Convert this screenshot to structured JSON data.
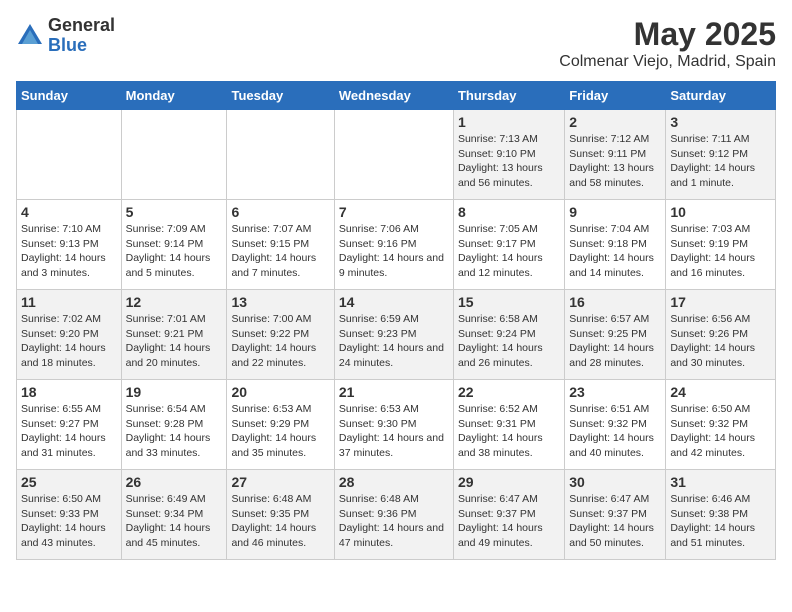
{
  "logo": {
    "general": "General",
    "blue": "Blue"
  },
  "title": "May 2025",
  "subtitle": "Colmenar Viejo, Madrid, Spain",
  "days_header": [
    "Sunday",
    "Monday",
    "Tuesday",
    "Wednesday",
    "Thursday",
    "Friday",
    "Saturday"
  ],
  "weeks": [
    [
      {
        "day": "",
        "sunrise": "",
        "sunset": "",
        "daylight": ""
      },
      {
        "day": "",
        "sunrise": "",
        "sunset": "",
        "daylight": ""
      },
      {
        "day": "",
        "sunrise": "",
        "sunset": "",
        "daylight": ""
      },
      {
        "day": "",
        "sunrise": "",
        "sunset": "",
        "daylight": ""
      },
      {
        "day": "1",
        "sunrise": "Sunrise: 7:13 AM",
        "sunset": "Sunset: 9:10 PM",
        "daylight": "Daylight: 13 hours and 56 minutes."
      },
      {
        "day": "2",
        "sunrise": "Sunrise: 7:12 AM",
        "sunset": "Sunset: 9:11 PM",
        "daylight": "Daylight: 13 hours and 58 minutes."
      },
      {
        "day": "3",
        "sunrise": "Sunrise: 7:11 AM",
        "sunset": "Sunset: 9:12 PM",
        "daylight": "Daylight: 14 hours and 1 minute."
      }
    ],
    [
      {
        "day": "4",
        "sunrise": "Sunrise: 7:10 AM",
        "sunset": "Sunset: 9:13 PM",
        "daylight": "Daylight: 14 hours and 3 minutes."
      },
      {
        "day": "5",
        "sunrise": "Sunrise: 7:09 AM",
        "sunset": "Sunset: 9:14 PM",
        "daylight": "Daylight: 14 hours and 5 minutes."
      },
      {
        "day": "6",
        "sunrise": "Sunrise: 7:07 AM",
        "sunset": "Sunset: 9:15 PM",
        "daylight": "Daylight: 14 hours and 7 minutes."
      },
      {
        "day": "7",
        "sunrise": "Sunrise: 7:06 AM",
        "sunset": "Sunset: 9:16 PM",
        "daylight": "Daylight: 14 hours and 9 minutes."
      },
      {
        "day": "8",
        "sunrise": "Sunrise: 7:05 AM",
        "sunset": "Sunset: 9:17 PM",
        "daylight": "Daylight: 14 hours and 12 minutes."
      },
      {
        "day": "9",
        "sunrise": "Sunrise: 7:04 AM",
        "sunset": "Sunset: 9:18 PM",
        "daylight": "Daylight: 14 hours and 14 minutes."
      },
      {
        "day": "10",
        "sunrise": "Sunrise: 7:03 AM",
        "sunset": "Sunset: 9:19 PM",
        "daylight": "Daylight: 14 hours and 16 minutes."
      }
    ],
    [
      {
        "day": "11",
        "sunrise": "Sunrise: 7:02 AM",
        "sunset": "Sunset: 9:20 PM",
        "daylight": "Daylight: 14 hours and 18 minutes."
      },
      {
        "day": "12",
        "sunrise": "Sunrise: 7:01 AM",
        "sunset": "Sunset: 9:21 PM",
        "daylight": "Daylight: 14 hours and 20 minutes."
      },
      {
        "day": "13",
        "sunrise": "Sunrise: 7:00 AM",
        "sunset": "Sunset: 9:22 PM",
        "daylight": "Daylight: 14 hours and 22 minutes."
      },
      {
        "day": "14",
        "sunrise": "Sunrise: 6:59 AM",
        "sunset": "Sunset: 9:23 PM",
        "daylight": "Daylight: 14 hours and 24 minutes."
      },
      {
        "day": "15",
        "sunrise": "Sunrise: 6:58 AM",
        "sunset": "Sunset: 9:24 PM",
        "daylight": "Daylight: 14 hours and 26 minutes."
      },
      {
        "day": "16",
        "sunrise": "Sunrise: 6:57 AM",
        "sunset": "Sunset: 9:25 PM",
        "daylight": "Daylight: 14 hours and 28 minutes."
      },
      {
        "day": "17",
        "sunrise": "Sunrise: 6:56 AM",
        "sunset": "Sunset: 9:26 PM",
        "daylight": "Daylight: 14 hours and 30 minutes."
      }
    ],
    [
      {
        "day": "18",
        "sunrise": "Sunrise: 6:55 AM",
        "sunset": "Sunset: 9:27 PM",
        "daylight": "Daylight: 14 hours and 31 minutes."
      },
      {
        "day": "19",
        "sunrise": "Sunrise: 6:54 AM",
        "sunset": "Sunset: 9:28 PM",
        "daylight": "Daylight: 14 hours and 33 minutes."
      },
      {
        "day": "20",
        "sunrise": "Sunrise: 6:53 AM",
        "sunset": "Sunset: 9:29 PM",
        "daylight": "Daylight: 14 hours and 35 minutes."
      },
      {
        "day": "21",
        "sunrise": "Sunrise: 6:53 AM",
        "sunset": "Sunset: 9:30 PM",
        "daylight": "Daylight: 14 hours and 37 minutes."
      },
      {
        "day": "22",
        "sunrise": "Sunrise: 6:52 AM",
        "sunset": "Sunset: 9:31 PM",
        "daylight": "Daylight: 14 hours and 38 minutes."
      },
      {
        "day": "23",
        "sunrise": "Sunrise: 6:51 AM",
        "sunset": "Sunset: 9:32 PM",
        "daylight": "Daylight: 14 hours and 40 minutes."
      },
      {
        "day": "24",
        "sunrise": "Sunrise: 6:50 AM",
        "sunset": "Sunset: 9:32 PM",
        "daylight": "Daylight: 14 hours and 42 minutes."
      }
    ],
    [
      {
        "day": "25",
        "sunrise": "Sunrise: 6:50 AM",
        "sunset": "Sunset: 9:33 PM",
        "daylight": "Daylight: 14 hours and 43 minutes."
      },
      {
        "day": "26",
        "sunrise": "Sunrise: 6:49 AM",
        "sunset": "Sunset: 9:34 PM",
        "daylight": "Daylight: 14 hours and 45 minutes."
      },
      {
        "day": "27",
        "sunrise": "Sunrise: 6:48 AM",
        "sunset": "Sunset: 9:35 PM",
        "daylight": "Daylight: 14 hours and 46 minutes."
      },
      {
        "day": "28",
        "sunrise": "Sunrise: 6:48 AM",
        "sunset": "Sunset: 9:36 PM",
        "daylight": "Daylight: 14 hours and 47 minutes."
      },
      {
        "day": "29",
        "sunrise": "Sunrise: 6:47 AM",
        "sunset": "Sunset: 9:37 PM",
        "daylight": "Daylight: 14 hours and 49 minutes."
      },
      {
        "day": "30",
        "sunrise": "Sunrise: 6:47 AM",
        "sunset": "Sunset: 9:37 PM",
        "daylight": "Daylight: 14 hours and 50 minutes."
      },
      {
        "day": "31",
        "sunrise": "Sunrise: 6:46 AM",
        "sunset": "Sunset: 9:38 PM",
        "daylight": "Daylight: 14 hours and 51 minutes."
      }
    ]
  ]
}
